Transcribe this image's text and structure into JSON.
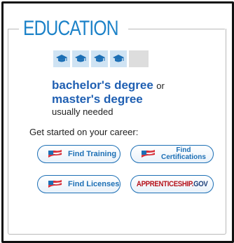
{
  "section": {
    "title": "EDUCATION"
  },
  "education_level": {
    "level": 4,
    "max_level": 5,
    "icon": "graduation-cap-icon"
  },
  "degree": {
    "primary": "bachelor's degree",
    "connector": "or",
    "secondary": "master's degree",
    "note": "usually needed"
  },
  "career": {
    "prompt": "Get started on your career:"
  },
  "buttons": {
    "find_training": "Find Training",
    "find_certifications_line1": "Find",
    "find_certifications_line2": "Certifications",
    "find_licenses": "Find Licenses",
    "apprenticeship_main": "APPRENTICESHIP.",
    "apprenticeship_gov": "GOV"
  },
  "colors": {
    "accent": "#1c82c8",
    "link": "#1f5fb2",
    "flag_red": "#d8303a",
    "cap_bg": "#cfe3f3"
  }
}
